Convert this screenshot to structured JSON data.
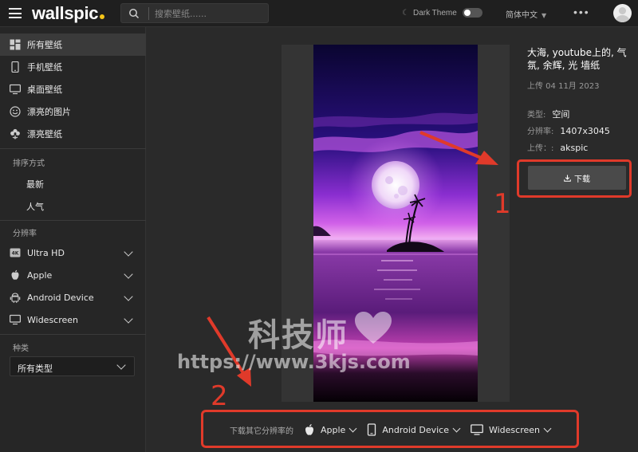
{
  "header": {
    "logo": "wallspic",
    "search_placeholder": "搜索壁纸......",
    "theme_label": "Dark Theme",
    "language": "简体中文",
    "more": "•••"
  },
  "sidebar": {
    "items": [
      {
        "label": "所有壁纸",
        "icon": "grid-icon"
      },
      {
        "label": "手机壁纸",
        "icon": "phone-icon"
      },
      {
        "label": "桌面壁纸",
        "icon": "monitor-icon"
      },
      {
        "label": "漂亮的图片",
        "icon": "smile-icon"
      },
      {
        "label": "漂亮壁纸",
        "icon": "flower-icon"
      }
    ],
    "sort_title": "排序方式",
    "sort_items": [
      "最新",
      "人气"
    ],
    "resolution_title": "分辨率",
    "resolutions": [
      {
        "label": "Ultra HD",
        "icon": "4k-icon"
      },
      {
        "label": "Apple",
        "icon": "apple-icon"
      },
      {
        "label": "Android Device",
        "icon": "android-icon"
      },
      {
        "label": "Widescreen",
        "icon": "monitor-icon"
      }
    ],
    "category_title": "种类",
    "category_value": "所有类型"
  },
  "details": {
    "title": "大海, youtube上的, 气氛, 余辉, 光 墙纸",
    "upload_date": "上传 04 11月 2023",
    "type_label": "类型:",
    "type_value": "空间",
    "resolution_label": "分辨率:",
    "resolution_value": "1407x3045",
    "uploader_label": "上传：:",
    "uploader_value": "akspic",
    "download_label": "下载"
  },
  "other_resolutions": {
    "label": "下载其它分辨率的",
    "options": [
      "Apple",
      "Android Device",
      "Widescreen"
    ]
  },
  "annotations": {
    "one": "1",
    "two": "2",
    "arrow_color": "#e03a2a"
  },
  "watermark": {
    "text": "科技师",
    "url": "https://www.3kjs.com"
  },
  "colors": {
    "accent": "#e03a2a",
    "logo_dot": "#f5c518",
    "background": "#2a2a2a"
  }
}
